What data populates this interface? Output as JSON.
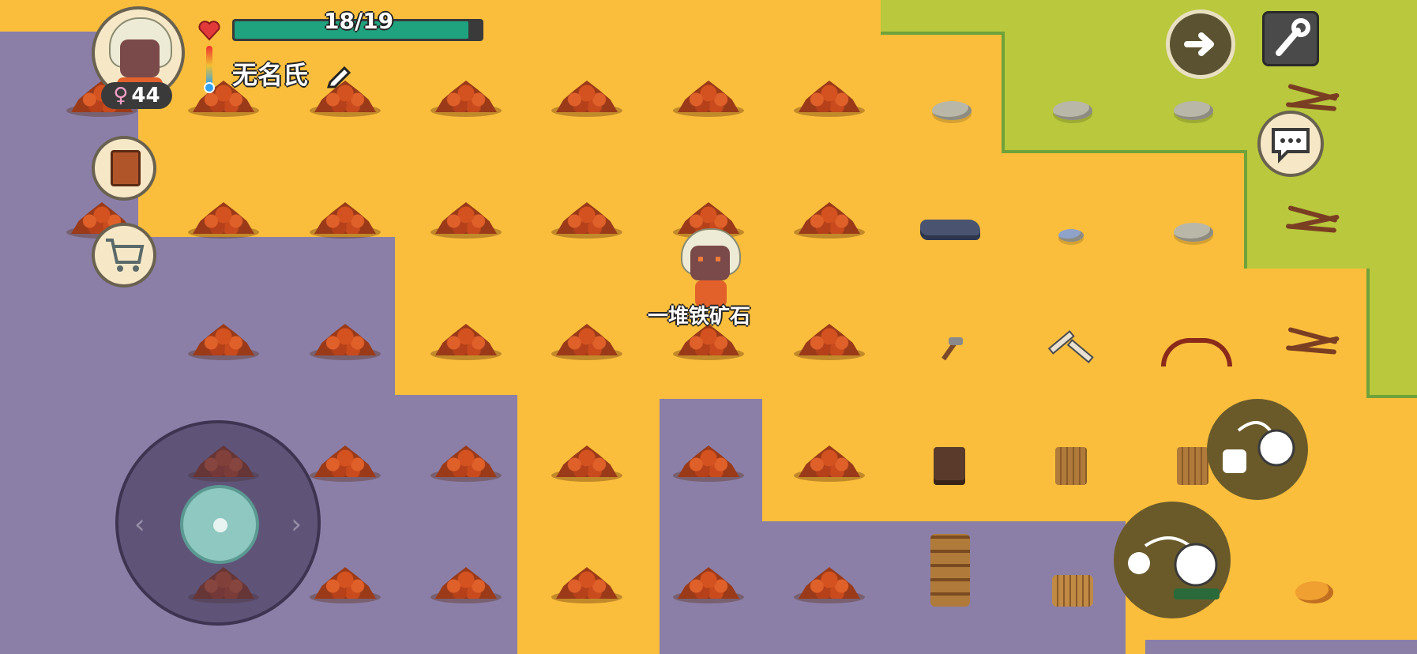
{
  "hud": {
    "health_text": "18/19",
    "health_value": 18,
    "health_max": 19,
    "player_name": "无名氏",
    "age": "44",
    "gender_symbol": "♀"
  },
  "world": {
    "object_label": "一堆铁矿石"
  },
  "colors": {
    "sand": "#FBBE3C",
    "purple_ground": "#8B7FA8",
    "grass": "#B9C83C",
    "health_fill": "#1FA37E",
    "ore": "#D4521F"
  },
  "icons": {
    "heart": "heart-icon",
    "thermometer": "thermometer-icon",
    "edit": "pencil-icon",
    "recipe_book": "book-icon",
    "shop": "cart-icon",
    "next": "arrow-right-icon",
    "settings": "wrench-icon",
    "chat": "speech-bubble-icon",
    "pickup": "grab-hand-icon",
    "drop": "drop-hand-icon",
    "joystick": "dpad-icon"
  }
}
